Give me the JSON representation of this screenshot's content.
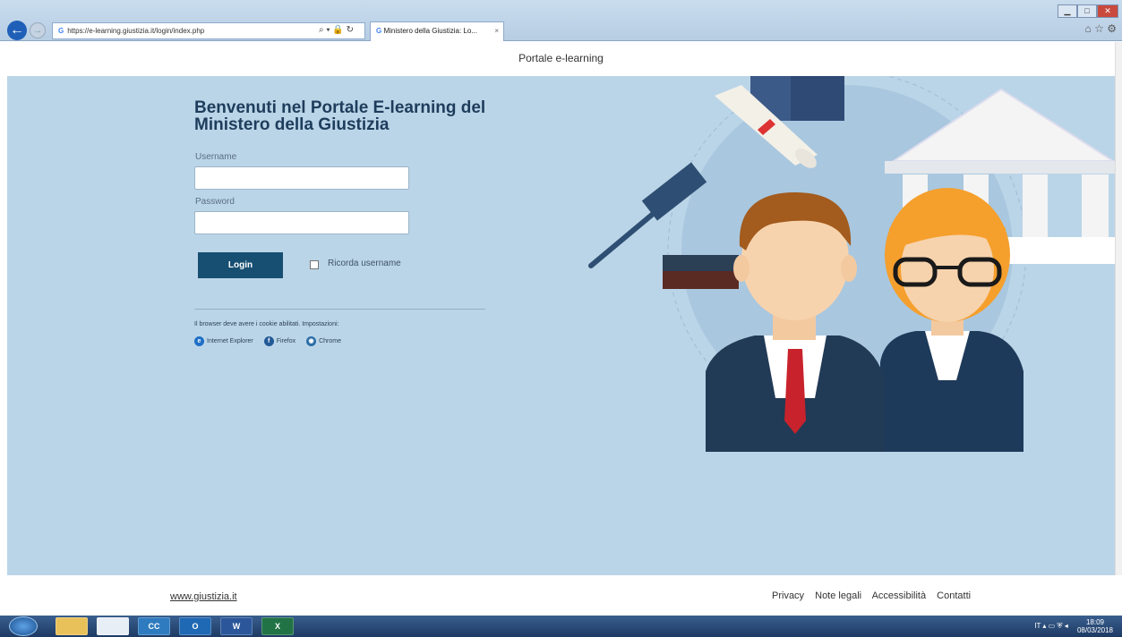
{
  "browser": {
    "url": "https://e-learning.giustizia.it/login/index.php",
    "tab_title": "Ministero della Giustizia: Lo...",
    "tab_close": "×"
  },
  "header": {
    "title": "Portale e-learning"
  },
  "login": {
    "heading": "Benvenuti nel Portale E-learning del Ministero della Giustizia",
    "username_label": "Username",
    "username_value": "",
    "password_label": "Password",
    "password_value": "",
    "login_button": "Login",
    "remember_label": "Ricorda username",
    "remember_checked": false,
    "cookie_note": "Il browser deve avere i cookie abilitati. Impostazioni:",
    "browser_links": [
      "Internet Explorer",
      "Firefox",
      "Chrome"
    ]
  },
  "footer": {
    "site_link": "www.giustizia.it",
    "links": [
      "Privacy",
      "Note legali",
      "Accessibilità",
      "Contatti"
    ]
  },
  "taskbar": {
    "apps": [
      "CC",
      "O",
      "W",
      "X"
    ],
    "language": "IT",
    "time": "18:09",
    "date": "08/03/2018"
  },
  "colors": {
    "page_background": "#bbd5e8",
    "heading": "#1e3d5c",
    "login_button": "#174f72"
  },
  "icons": [
    "back-arrow-icon",
    "forward-arrow-icon",
    "google-icon",
    "search-icon",
    "lock-icon",
    "refresh-icon",
    "home-icon",
    "star-icon",
    "gear-icon",
    "internet-explorer-icon",
    "firefox-icon",
    "chrome-icon",
    "windows-start-icon",
    "checkbox-icon"
  ]
}
